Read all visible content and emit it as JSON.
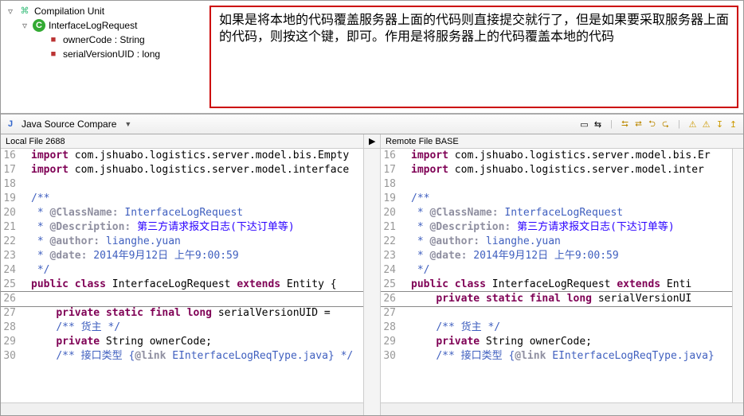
{
  "outline": {
    "root_label": "Compilation Unit",
    "class_label": "InterfaceLogRequest",
    "fields": [
      {
        "label": "ownerCode : String"
      },
      {
        "label": "serialVersionUID : long"
      }
    ]
  },
  "annotation": {
    "text": "如果是将本地的代码覆盖服务器上面的代码则直接提交就行了，但是如果要采取服务器上面的代码，则按这个键，即可。作用是将服务器上的代码覆盖本地的代码"
  },
  "compare_header": {
    "title": "Java Source Compare",
    "java_icon": "J"
  },
  "toolbar_icons": {
    "structure": "▭",
    "swap": "⇆",
    "sep1": "|",
    "copy_all_left": "⮀",
    "copy_all_right": "⮂",
    "copy_left": "⮌",
    "copy_right": "⮎",
    "sep2": "|",
    "next_diff": "⚠",
    "prev_diff": "⚠",
    "next_change": "↧",
    "prev_change": "↥"
  },
  "panes": {
    "left": {
      "title": "Local File 2688",
      "lines": [
        {
          "n": 16,
          "html": "<span class='kw'>import</span> com.jshuabo.logistics.server.model.bis.Empty"
        },
        {
          "n": 17,
          "html": "<span class='kw'>import</span> com.jshuabo.logistics.server.model.interface"
        },
        {
          "n": 18,
          "html": ""
        },
        {
          "n": 19,
          "html": "<span class='cm'>/**</span>"
        },
        {
          "n": 20,
          "html": "<span class='cm'> * </span><span class='tag'>@ClassName:</span><span class='cm'> InterfaceLogRequest</span>"
        },
        {
          "n": 21,
          "html": "<span class='cm'> * </span><span class='tag'>@Description:</span><span class='cm'> </span><span class='str'>第三方请求报文日志(下达订单等)</span>"
        },
        {
          "n": 22,
          "html": "<span class='cm'> * </span><span class='tag'>@author:</span><span class='cm'> lianghe.yuan</span>"
        },
        {
          "n": 23,
          "html": "<span class='cm'> * </span><span class='tag'>@date:</span><span class='cm'> 2014年9月12日 上午9:00:59</span>"
        },
        {
          "n": 24,
          "html": "<span class='cm'> */</span>"
        },
        {
          "n": 25,
          "html": "<span class='kw'>public</span> <span class='kw'>class</span> InterfaceLogRequest <span class='kw'>extends</span> Entity {"
        },
        {
          "n": 26,
          "diff": true,
          "box": true,
          "html": ""
        },
        {
          "n": 27,
          "diff": true,
          "html": "    <span class='kw'>private</span> <span class='kw'>static</span> <span class='kw'>final</span> <span class='kw'>long</span> serialVersionUID ="
        },
        {
          "n": 28,
          "diff": true,
          "html": "    <span class='cm'>/** 货主 */</span>"
        },
        {
          "n": 29,
          "html": "    <span class='kw'>private</span> String ownerCode;"
        },
        {
          "n": 30,
          "html": "    <span class='cm'>/** 接口类型 {</span><span class='tag'>@link</span><span class='cm'> EInterfaceLogReqType.java} */</span>"
        }
      ]
    },
    "right": {
      "title": "Remote File BASE",
      "lines": [
        {
          "n": 16,
          "html": "<span class='kw'>import</span> com.jshuabo.logistics.server.model.bis.Er"
        },
        {
          "n": 17,
          "html": "<span class='kw'>import</span> com.jshuabo.logistics.server.model.inter"
        },
        {
          "n": 18,
          "html": ""
        },
        {
          "n": 19,
          "html": "<span class='cm'>/**</span>"
        },
        {
          "n": 20,
          "html": "<span class='cm'> * </span><span class='tag'>@ClassName:</span><span class='cm'> InterfaceLogRequest</span>"
        },
        {
          "n": 21,
          "html": "<span class='cm'> * </span><span class='tag'>@Description:</span><span class='cm'> </span><span class='str'>第三方请求报文日志(下达订单等)</span>"
        },
        {
          "n": 22,
          "html": "<span class='cm'> * </span><span class='tag'>@author:</span><span class='cm'> lianghe.yuan</span>"
        },
        {
          "n": 23,
          "html": "<span class='cm'> * </span><span class='tag'>@date:</span><span class='cm'> 2014年9月12日 上午9:00:59</span>"
        },
        {
          "n": 24,
          "html": "<span class='cm'> */</span>"
        },
        {
          "n": 25,
          "html": "<span class='kw'>public</span> <span class='kw'>class</span> InterfaceLogRequest <span class='kw'>extends</span> Enti"
        },
        {
          "n": 26,
          "diff": true,
          "box": true,
          "html": "    <span class='kw'>private</span> <span class='kw'>static</span> <span class='kw'>final</span> <span class='kw'>long</span> serialVersionUI"
        },
        {
          "n": 27,
          "diff": true,
          "html": ""
        },
        {
          "n": 28,
          "diff": true,
          "html": "    <span class='cm'>/** 货主 */</span>"
        },
        {
          "n": 29,
          "html": "    <span class='kw'>private</span> String ownerCode;"
        },
        {
          "n": 30,
          "html": "    <span class='cm'>/** 接口类型 {</span><span class='tag'>@link</span><span class='cm'> EInterfaceLogReqType.java}</span>"
        }
      ]
    }
  }
}
